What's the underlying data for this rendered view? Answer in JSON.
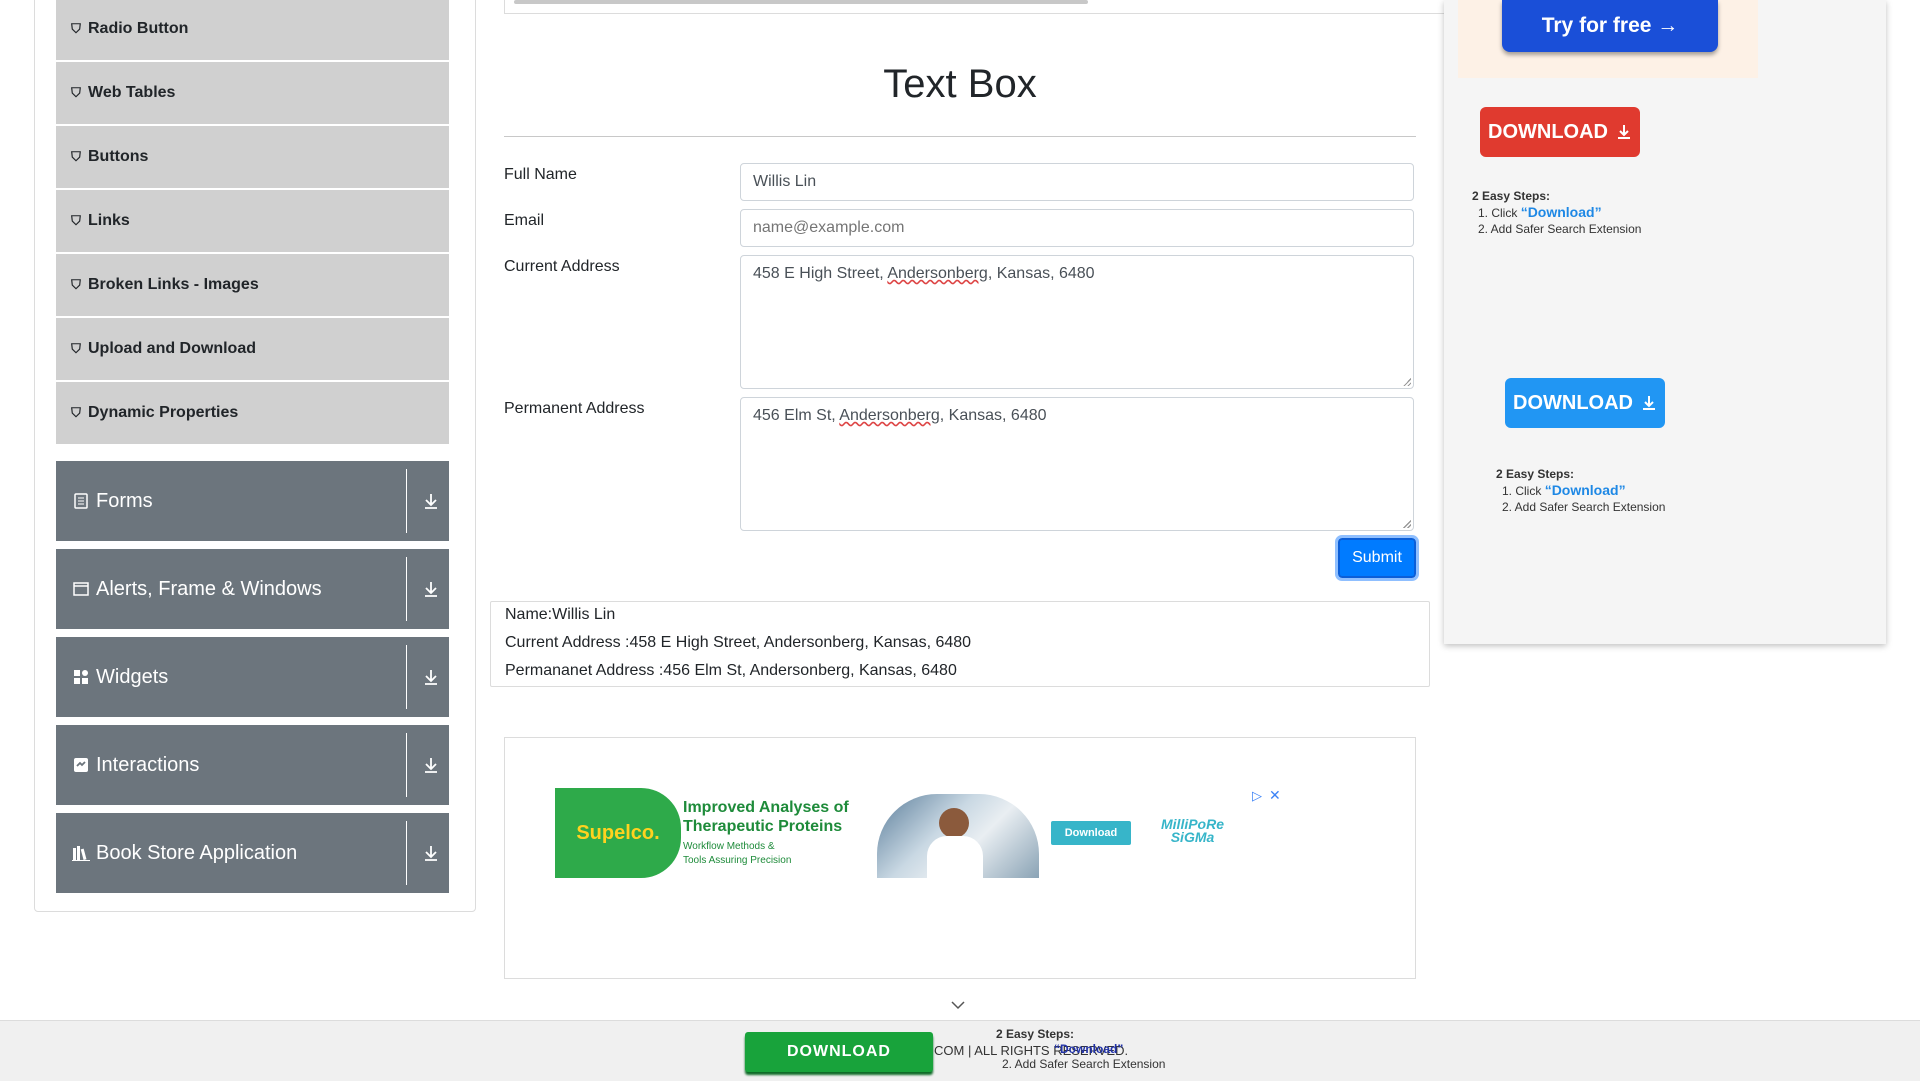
{
  "sidebar": {
    "sub_items": [
      {
        "label": "Radio Button"
      },
      {
        "label": "Web Tables"
      },
      {
        "label": "Buttons"
      },
      {
        "label": "Links"
      },
      {
        "label": "Broken Links - Images"
      },
      {
        "label": "Upload and Download"
      },
      {
        "label": "Dynamic Properties"
      }
    ],
    "groups": [
      {
        "label": "Forms",
        "icon": "document-icon"
      },
      {
        "label": "Alerts, Frame & Windows",
        "icon": "window-icon"
      },
      {
        "label": "Widgets",
        "icon": "widgets-icon"
      },
      {
        "label": "Interactions",
        "icon": "interactions-icon"
      },
      {
        "label": "Book Store Application",
        "icon": "books-icon"
      }
    ]
  },
  "main": {
    "title": "Text Box",
    "full_name_label": "Full Name",
    "full_name_value": "Willis Lin",
    "email_label": "Email",
    "email_placeholder": "name@example.com",
    "current_address_label": "Current Address",
    "current_address_value_a": "458 E High Street, ",
    "current_address_value_b": "Andersonberg",
    "current_address_value_c": ", Kansas, 6480",
    "permanent_address_label": "Permanent Address",
    "permanent_address_value_a": "456 Elm St, ",
    "permanent_address_value_b": "Andersonberg",
    "permanent_address_value_c": ", Kansas, 6480",
    "submit_label": "Submit"
  },
  "output": {
    "name": "Name:Willis Lin",
    "current_address": "Current Address :458 E High Street, Andersonberg, Kansas, 6480",
    "permanent_address": "Permananet Address :456 Elm St, Andersonberg, Kansas, 6480"
  },
  "banner_ad": {
    "brand": "Supelco.",
    "headline_1": "Improved Analyses of",
    "headline_2": "Therapeutic Proteins",
    "sub_1": "Workflow Methods &",
    "sub_2": "Tools Assuring Precision",
    "button": "Download",
    "partner_1": "MilliPoRe",
    "partner_2": "SiGMa"
  },
  "right_ad": {
    "try_free": "Try for free →",
    "download": "DOWNLOAD",
    "steps_title": "2 Easy Steps:",
    "step1_prefix": "1. Click ",
    "step1_link": "“Download”",
    "step2": "2. Add Safer Search Extension"
  },
  "footer": {
    "download": "DOWNLOAD",
    "text": "COM | ALL RIGHTS RESERVED.",
    "steps_title": "2 Easy Steps:",
    "step1_link": "“Download”",
    "step2": "2. Add Safer Search Extension"
  },
  "colors": {
    "primary": "#007bff",
    "sidebar_group": "#6c757d",
    "sidebar_item": "#d0d0d0",
    "ad_red": "#e03a2f",
    "ad_blue": "#2196f3",
    "footer_green": "#18a33b"
  }
}
